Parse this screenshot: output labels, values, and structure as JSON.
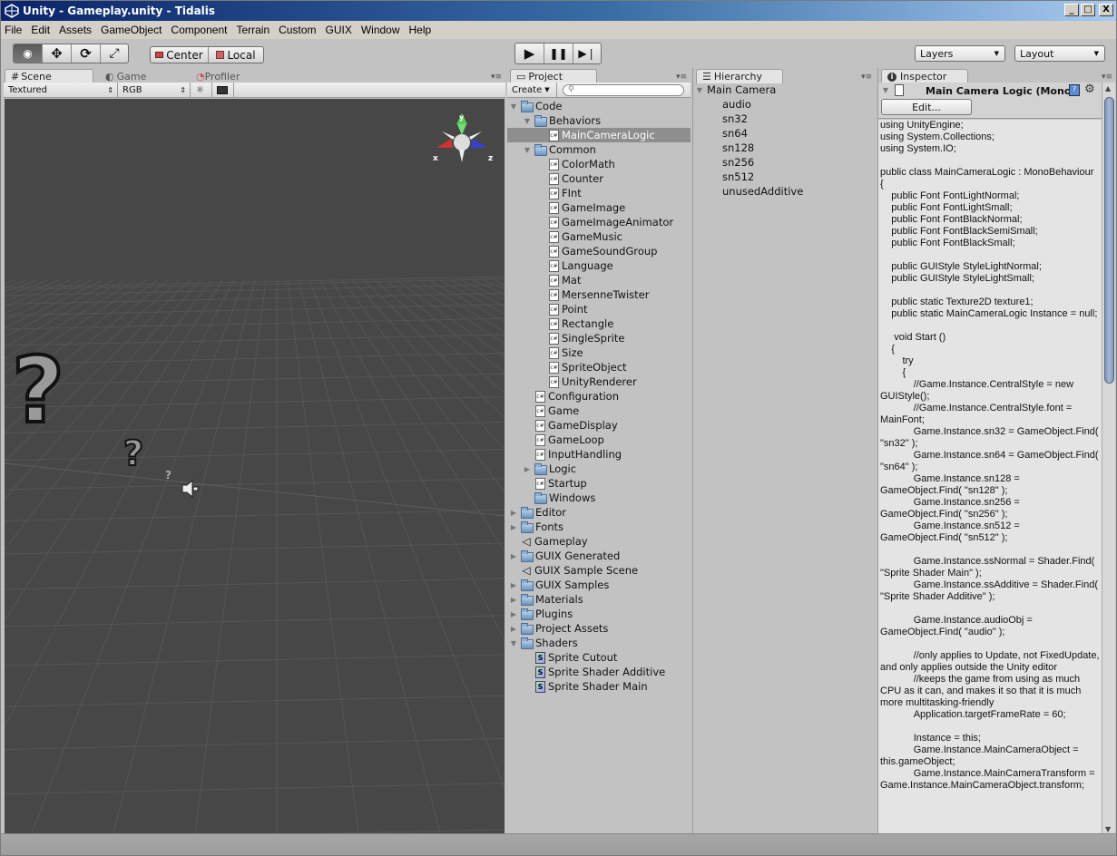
{
  "window": {
    "title": "Unity - Gameplay.unity - Tidalis",
    "controls": [
      "_",
      "□",
      "X"
    ]
  },
  "menu": [
    "File",
    "Edit",
    "Assets",
    "GameObject",
    "Component",
    "Terrain",
    "Custom",
    "GUIX",
    "Window",
    "Help"
  ],
  "toolbar": {
    "tools": [
      {
        "name": "view-tool",
        "icon": "eye-icon",
        "glyph": "◉"
      },
      {
        "name": "move-tool",
        "icon": "move-icon",
        "glyph": "✥"
      },
      {
        "name": "rotate-tool",
        "icon": "rotate-icon",
        "glyph": "⟳"
      },
      {
        "name": "scale-tool",
        "icon": "scale-icon",
        "glyph": "⤢"
      }
    ],
    "pivot_label": "Center",
    "space_label": "Local",
    "play_glyph": "▶",
    "pause_glyph": "❚❚",
    "step_glyph": "▶❘",
    "layers_label": "Layers",
    "layout_label": "Layout"
  },
  "scene_panel": {
    "tabs": [
      {
        "label": "Scene",
        "icon": "#"
      },
      {
        "label": "Game",
        "icon": "◐"
      },
      {
        "label": "Profiler",
        "icon": "◔"
      }
    ],
    "render_mode": "Textured",
    "color_mode": "RGB",
    "gizmo_labels": {
      "x": "x",
      "y": "y",
      "z": "z"
    }
  },
  "project_panel": {
    "tab_label": "Project",
    "create_label": "Create",
    "search_placeholder": "",
    "items": [
      {
        "label": "Code",
        "type": "folder",
        "depth": 0,
        "expanded": true
      },
      {
        "label": "Behaviors",
        "type": "folder",
        "depth": 1,
        "expanded": true
      },
      {
        "label": "MainCameraLogic",
        "type": "script",
        "depth": 2,
        "selected": true
      },
      {
        "label": "Common",
        "type": "folder",
        "depth": 1,
        "expanded": true
      },
      {
        "label": "ColorMath",
        "type": "script",
        "depth": 2
      },
      {
        "label": "Counter",
        "type": "script",
        "depth": 2
      },
      {
        "label": "FInt",
        "type": "script",
        "depth": 2
      },
      {
        "label": "GameImage",
        "type": "script",
        "depth": 2
      },
      {
        "label": "GameImageAnimator",
        "type": "script",
        "depth": 2
      },
      {
        "label": "GameMusic",
        "type": "script",
        "depth": 2
      },
      {
        "label": "GameSoundGroup",
        "type": "script",
        "depth": 2
      },
      {
        "label": "Language",
        "type": "script",
        "depth": 2
      },
      {
        "label": "Mat",
        "type": "script",
        "depth": 2
      },
      {
        "label": "MersenneTwister",
        "type": "script",
        "depth": 2
      },
      {
        "label": "Point",
        "type": "script",
        "depth": 2
      },
      {
        "label": "Rectangle",
        "type": "script",
        "depth": 2
      },
      {
        "label": "SingleSprite",
        "type": "script",
        "depth": 2
      },
      {
        "label": "Size",
        "type": "script",
        "depth": 2
      },
      {
        "label": "SpriteObject",
        "type": "script",
        "depth": 2
      },
      {
        "label": "UnityRenderer",
        "type": "script",
        "depth": 2
      },
      {
        "label": "Configuration",
        "type": "script",
        "depth": 1
      },
      {
        "label": "Game",
        "type": "script",
        "depth": 1
      },
      {
        "label": "GameDisplay",
        "type": "script",
        "depth": 1
      },
      {
        "label": "GameLoop",
        "type": "script",
        "depth": 1
      },
      {
        "label": "InputHandling",
        "type": "script",
        "depth": 1
      },
      {
        "label": "Logic",
        "type": "folder",
        "depth": 1,
        "expanded": false
      },
      {
        "label": "Startup",
        "type": "script",
        "depth": 1
      },
      {
        "label": "Windows",
        "type": "folder",
        "depth": 1,
        "leaf": true
      },
      {
        "label": "Editor",
        "type": "folder",
        "depth": 0,
        "expanded": false
      },
      {
        "label": "Fonts",
        "type": "folder",
        "depth": 0,
        "expanded": false
      },
      {
        "label": "Gameplay",
        "type": "scene",
        "depth": 0
      },
      {
        "label": "GUIX Generated",
        "type": "folder",
        "depth": 0,
        "expanded": false
      },
      {
        "label": "GUIX Sample Scene",
        "type": "scene",
        "depth": 0
      },
      {
        "label": "GUIX Samples",
        "type": "folder",
        "depth": 0,
        "expanded": false
      },
      {
        "label": "Materials",
        "type": "folder",
        "depth": 0,
        "expanded": false
      },
      {
        "label": "Plugins",
        "type": "folder",
        "depth": 0,
        "expanded": false
      },
      {
        "label": "Project Assets",
        "type": "folder",
        "depth": 0,
        "expanded": false
      },
      {
        "label": "Shaders",
        "type": "folder",
        "depth": 0,
        "expanded": true
      },
      {
        "label": "Sprite Cutout",
        "type": "shader",
        "depth": 1
      },
      {
        "label": "Sprite Shader Additive",
        "type": "shader",
        "depth": 1
      },
      {
        "label": "Sprite Shader Main",
        "type": "shader",
        "depth": 1
      }
    ]
  },
  "hierarchy_panel": {
    "tab_label": "Hierarchy",
    "root": "Main Camera",
    "children": [
      "audio",
      "sn32",
      "sn64",
      "sn128",
      "sn256",
      "sn512",
      "unusedAdditive"
    ]
  },
  "inspector_panel": {
    "tab_label": "Inspector",
    "component_title": "Main Camera Logic (Mono Script)",
    "edit_label": "Edit...",
    "code": "using UnityEngine;\nusing System.Collections;\nusing System.IO;\n\npublic class MainCameraLogic : MonoBehaviour\n{\n    public Font FontLightNormal;\n    public Font FontLightSmall;\n    public Font FontBlackNormal;\n    public Font FontBlackSemiSmall;\n    public Font FontBlackSmall;\n\n    public GUIStyle StyleLightNormal;\n    public GUIStyle StyleLightSmall;\n\n    public static Texture2D texture1;\n    public static MainCameraLogic Instance = null;\n\n     void Start ()\n    {\n        try\n        {\n            //Game.Instance.CentralStyle = new GUIStyle();\n            //Game.Instance.CentralStyle.font = MainFont;\n            Game.Instance.sn32 = GameObject.Find( \"sn32\" );\n            Game.Instance.sn64 = GameObject.Find( \"sn64\" );\n            Game.Instance.sn128 = GameObject.Find( \"sn128\" );\n            Game.Instance.sn256 = GameObject.Find( \"sn256\" );\n            Game.Instance.sn512 = GameObject.Find( \"sn512\" );\n\n            Game.Instance.ssNormal = Shader.Find( \"Sprite Shader Main\" );\n            Game.Instance.ssAdditive = Shader.Find( \"Sprite Shader Additive\" );\n\n            Game.Instance.audioObj = GameObject.Find( \"audio\" );\n\n            //only applies to Update, not FixedUpdate, and only applies outside the Unity editor\n            //keeps the game from using as much CPU as it can, and makes it so that it is much more multitasking-friendly\n            Application.targetFrameRate = 60;\n\n            Instance = this;\n            Game.Instance.MainCameraObject = this.gameObject;\n            Game.Instance.MainCameraTransform = Game.Instance.MainCameraObject.transform;"
  }
}
